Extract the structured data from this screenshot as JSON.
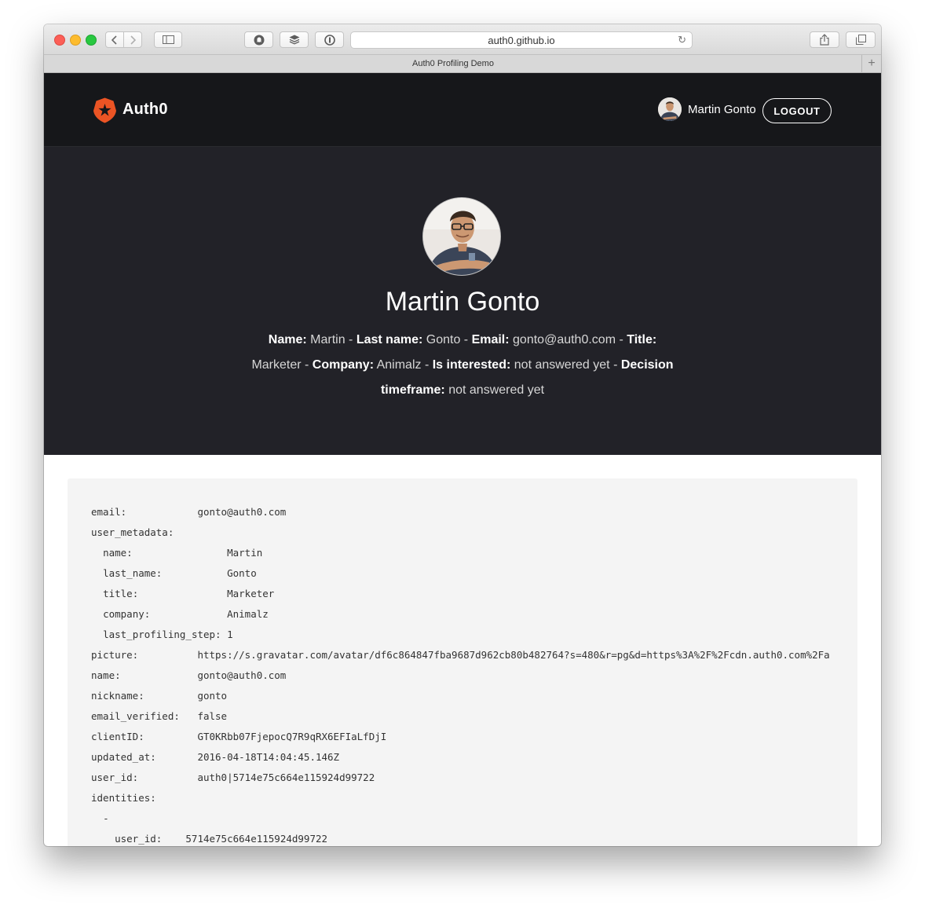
{
  "browser": {
    "url": "auth0.github.io",
    "tab_title": "Auth0 Profiling Demo",
    "new_tab_symbol": "+"
  },
  "navbar": {
    "brand": "Auth0",
    "brand_color": "#eb5424",
    "user_name": "Martin Gonto",
    "logout_label": "LOGOUT"
  },
  "hero": {
    "name": "Martin Gonto",
    "details": [
      {
        "label": "Name:",
        "value": "Martin"
      },
      {
        "label": "Last name:",
        "value": "Gonto"
      },
      {
        "label": "Email:",
        "value": "gonto@auth0.com"
      },
      {
        "label": "Title:",
        "value": "Marketer"
      },
      {
        "label": "Company:",
        "value": "Animalz"
      },
      {
        "label": "Is interested:",
        "value": "not answered yet"
      },
      {
        "label": "Decision timeframe:",
        "value": "not answered yet"
      }
    ]
  },
  "profile_yaml": [
    {
      "indent": 0,
      "key": "email:",
      "pad": 18,
      "value": "gonto@auth0.com"
    },
    {
      "indent": 0,
      "key": "user_metadata:",
      "pad": 0,
      "value": ""
    },
    {
      "indent": 2,
      "key": "name:",
      "pad": 21,
      "value": "Martin"
    },
    {
      "indent": 2,
      "key": "last_name:",
      "pad": 21,
      "value": "Gonto"
    },
    {
      "indent": 2,
      "key": "title:",
      "pad": 21,
      "value": "Marketer"
    },
    {
      "indent": 2,
      "key": "company:",
      "pad": 21,
      "value": "Animalz"
    },
    {
      "indent": 2,
      "key": "last_profiling_step:",
      "pad": 21,
      "value": "1"
    },
    {
      "indent": 0,
      "key": "picture:",
      "pad": 18,
      "value": "https://s.gravatar.com/avatar/df6c864847fba9687d962cb80b482764?s=480&r=pg&d=https%3A%2F%2Fcdn.auth0.com%2Fa"
    },
    {
      "indent": 0,
      "key": "name:",
      "pad": 18,
      "value": "gonto@auth0.com"
    },
    {
      "indent": 0,
      "key": "nickname:",
      "pad": 18,
      "value": "gonto"
    },
    {
      "indent": 0,
      "key": "email_verified:",
      "pad": 18,
      "value": "false"
    },
    {
      "indent": 0,
      "key": "clientID:",
      "pad": 18,
      "value": "GT0KRbb07FjepocQ7R9qRX6EFIaLfDjI"
    },
    {
      "indent": 0,
      "key": "updated_at:",
      "pad": 18,
      "value": "2016-04-18T14:04:45.146Z"
    },
    {
      "indent": 0,
      "key": "user_id:",
      "pad": 18,
      "value": "auth0|5714e75c664e115924d99722"
    },
    {
      "indent": 0,
      "key": "identities:",
      "pad": 0,
      "value": ""
    },
    {
      "indent": 2,
      "key": "-",
      "pad": 0,
      "value": ""
    },
    {
      "indent": 4,
      "key": "user_id:",
      "pad": 12,
      "value": "5714e75c664e115924d99722"
    }
  ]
}
